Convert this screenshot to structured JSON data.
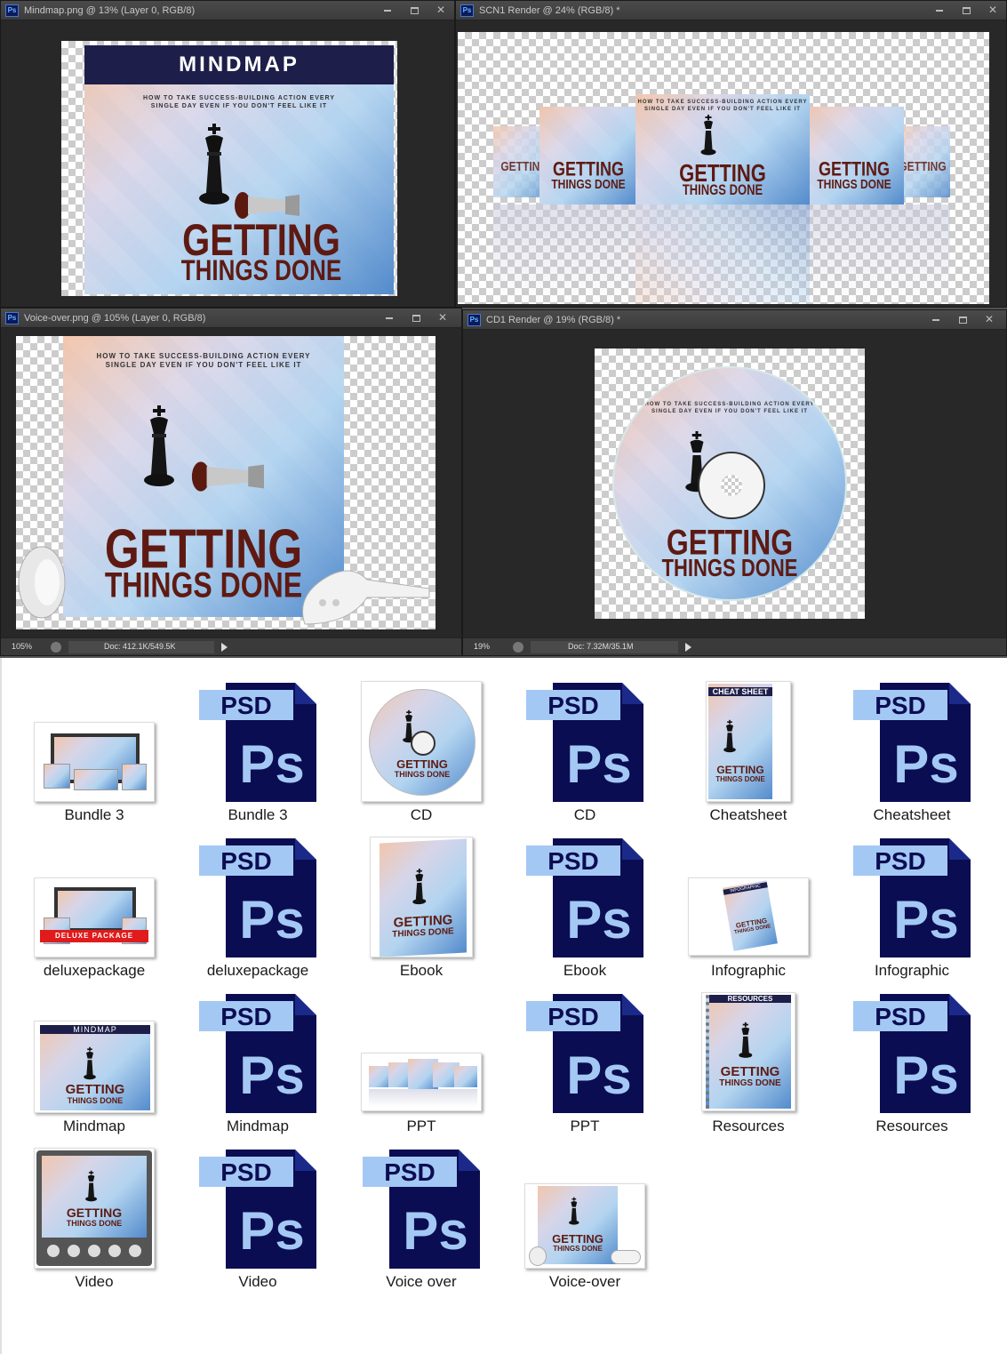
{
  "windows": [
    {
      "title": "Mindmap.png @ 13% (Layer 0, RGB/8)"
    },
    {
      "title": "SCN1 Render @ 24% (RGB/8) *"
    },
    {
      "title": "Voice-over.png @ 105% (Layer 0, RGB/8)",
      "zoom": "105%",
      "doc": "Doc: 412.1K/549.5K"
    },
    {
      "title": "CD1 Render @ 19% (RGB/8) *",
      "zoom": "19%",
      "doc": "Doc: 7.32M/35.1M"
    }
  ],
  "cover": {
    "banner": "MINDMAP",
    "tagline1": "HOW TO TAKE SUCCESS-BUILDING ACTION EVERY",
    "tagline2": "SINGLE DAY EVEN IF YOU DON'T FEEL LIKE IT",
    "title1": "GETTING",
    "title2": "THINGS DONE"
  },
  "psd_icon": {
    "badge": "PSD",
    "letters": "Ps"
  },
  "thumb_text": {
    "cheat_sheet": "CHEAT SHEET",
    "deluxe_package": "DELUXE PACKAGE",
    "infographic": "INFOGRAPHIC",
    "resources": "RESOURCES"
  },
  "files": [
    {
      "label": "Bundle 3"
    },
    {
      "label": "Bundle 3"
    },
    {
      "label": "CD"
    },
    {
      "label": "CD"
    },
    {
      "label": "Cheatsheet"
    },
    {
      "label": "Cheatsheet"
    },
    {
      "label": "deluxepackage"
    },
    {
      "label": "deluxepackage"
    },
    {
      "label": "Ebook"
    },
    {
      "label": "Ebook"
    },
    {
      "label": "Infographic"
    },
    {
      "label": "Infographic"
    },
    {
      "label": "Mindmap"
    },
    {
      "label": "Mindmap"
    },
    {
      "label": "PPT"
    },
    {
      "label": "PPT"
    },
    {
      "label": "Resources"
    },
    {
      "label": "Resources"
    },
    {
      "label": "Video"
    },
    {
      "label": "Video"
    },
    {
      "label": "Voice over"
    },
    {
      "label": "Voice-over"
    }
  ],
  "colors": {
    "ps_panel": "#282828",
    "psd_dark": "#0b0d52",
    "psd_light": "#a4c8f4",
    "title_red": "#5e1a12"
  }
}
